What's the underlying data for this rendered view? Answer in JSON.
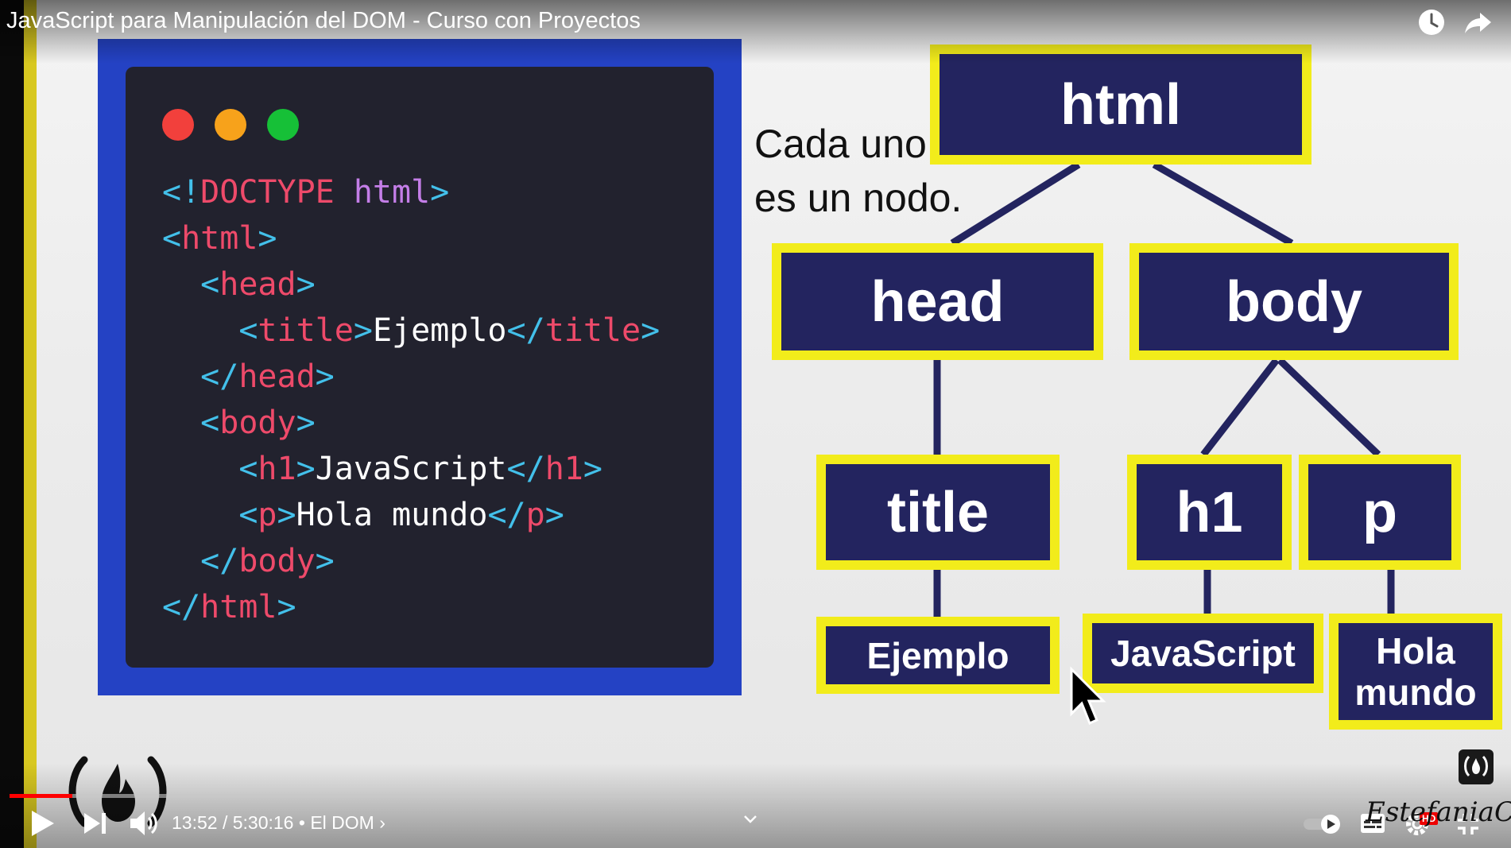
{
  "video": {
    "title": "JavaScript para Manipulación del DOM - Curso con Proyectos",
    "current_time": "13:52",
    "duration": "5:30:16",
    "chapter": "El DOM",
    "progress": 0.042,
    "watermark": "EstefaniaCN",
    "hd_badge": "HD"
  },
  "icons": {
    "watch_later": "clock-icon",
    "share": "share-arrow-icon",
    "play": "play-icon",
    "next": "skip-next-icon",
    "volume": "volume-icon",
    "chapter_chevron": "chevron-down-icon",
    "autoplay": "autoplay-toggle-icon",
    "subtitles": "subtitles-icon",
    "settings": "gear-icon",
    "fullscreen": "exit-fullscreen-icon",
    "subscribe": "channel-subscribe-icon",
    "channel_logo": "freecodecamp-logo-icon"
  },
  "code_panel": {
    "dot_colors": [
      "#f2403c",
      "#f7a21b",
      "#16c037"
    ],
    "lines": [
      [
        {
          "c": "p",
          "v": "<!"
        },
        {
          "c": "t",
          "v": "DOCTYPE"
        },
        {
          "c": "x",
          "v": " "
        },
        {
          "c": "a",
          "v": "html"
        },
        {
          "c": "p",
          "v": ">"
        }
      ],
      [
        {
          "c": "p",
          "v": "<"
        },
        {
          "c": "t",
          "v": "html"
        },
        {
          "c": "p",
          "v": ">"
        }
      ],
      [
        {
          "c": "x",
          "v": "  "
        },
        {
          "c": "p",
          "v": "<"
        },
        {
          "c": "t",
          "v": "head"
        },
        {
          "c": "p",
          "v": ">"
        }
      ],
      [
        {
          "c": "x",
          "v": "    "
        },
        {
          "c": "p",
          "v": "<"
        },
        {
          "c": "t",
          "v": "title"
        },
        {
          "c": "p",
          "v": ">"
        },
        {
          "c": "x",
          "v": "Ejemplo"
        },
        {
          "c": "p",
          "v": "</"
        },
        {
          "c": "t",
          "v": "title"
        },
        {
          "c": "p",
          "v": ">"
        }
      ],
      [
        {
          "c": "x",
          "v": "  "
        },
        {
          "c": "p",
          "v": "</"
        },
        {
          "c": "t",
          "v": "head"
        },
        {
          "c": "p",
          "v": ">"
        }
      ],
      [
        {
          "c": "x",
          "v": "  "
        },
        {
          "c": "p",
          "v": "<"
        },
        {
          "c": "t",
          "v": "body"
        },
        {
          "c": "p",
          "v": ">"
        }
      ],
      [
        {
          "c": "x",
          "v": "    "
        },
        {
          "c": "p",
          "v": "<"
        },
        {
          "c": "t",
          "v": "h1"
        },
        {
          "c": "p",
          "v": ">"
        },
        {
          "c": "x",
          "v": "JavaScript"
        },
        {
          "c": "p",
          "v": "</"
        },
        {
          "c": "t",
          "v": "h1"
        },
        {
          "c": "p",
          "v": ">"
        }
      ],
      [
        {
          "c": "x",
          "v": "    "
        },
        {
          "c": "p",
          "v": "<"
        },
        {
          "c": "t",
          "v": "p"
        },
        {
          "c": "p",
          "v": ">"
        },
        {
          "c": "x",
          "v": "Hola mundo"
        },
        {
          "c": "p",
          "v": "</"
        },
        {
          "c": "t",
          "v": "p"
        },
        {
          "c": "p",
          "v": ">"
        }
      ],
      [
        {
          "c": "x",
          "v": "  "
        },
        {
          "c": "p",
          "v": "</"
        },
        {
          "c": "t",
          "v": "body"
        },
        {
          "c": "p",
          "v": ">"
        }
      ],
      [
        {
          "c": "p",
          "v": "</"
        },
        {
          "c": "t",
          "v": "html"
        },
        {
          "c": "p",
          "v": ">"
        }
      ]
    ]
  },
  "tree": {
    "caption_line1": "Cada uno",
    "caption_line2": "es un nodo.",
    "nodes": {
      "html": "html",
      "head": "head",
      "body": "body",
      "title": "title",
      "h1": "h1",
      "p": "p",
      "text_ejemplo": "Ejemplo",
      "text_javascript": "JavaScript",
      "text_hola_line1": "Hola",
      "text_hola_line2": "mundo"
    },
    "colors": {
      "node_fill": "#23245f",
      "node_border": "#f2ec1b",
      "edge": "#23245f"
    }
  }
}
